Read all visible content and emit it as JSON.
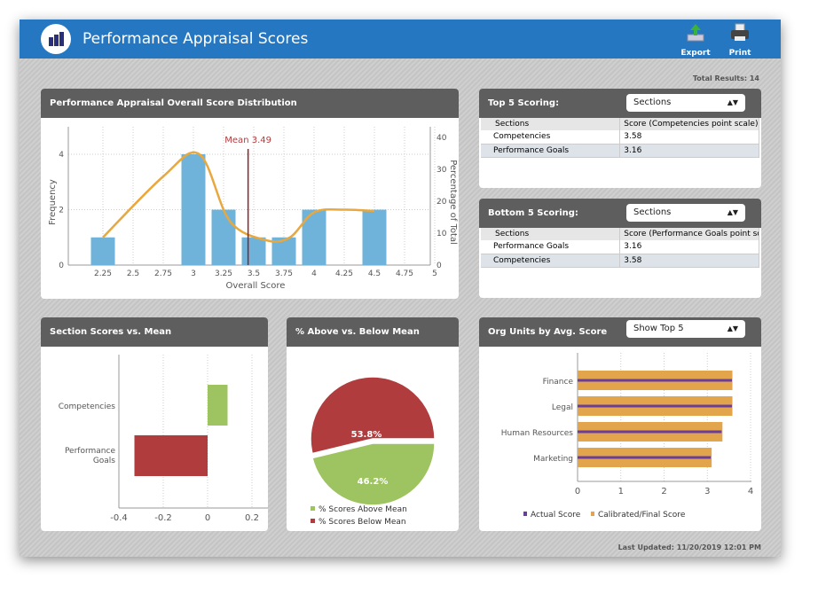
{
  "header": {
    "title": "Performance Appraisal Scores",
    "logo_icon": "bar-chart-icon",
    "export_label": "Export",
    "print_label": "Print"
  },
  "total_results": "Total Results: 14",
  "last_updated": "Last Updated: 11/20/2019 12:01 PM",
  "colors": {
    "header": "#2577c2",
    "panel_header": "#5e5e5e",
    "bar_blue": "#6fb3da",
    "curve": "#e8a83e",
    "mean": "#9b1c1c",
    "green": "#9dc461",
    "red": "#b03c3d",
    "actual": "#6a3d9a",
    "calibrated": "#e2a54c"
  },
  "distribution": {
    "title": "Performance Appraisal Overall Score Distribution"
  },
  "top5": {
    "title": "Top 5 Scoring:",
    "select": "Sections",
    "columns": [
      "Sections",
      "Score (Competencies point scale)"
    ],
    "rows": [
      [
        "Competencies",
        "3.58"
      ],
      [
        "Performance Goals",
        "3.16"
      ]
    ]
  },
  "bottom5": {
    "title": "Bottom 5 Scoring:",
    "select": "Sections",
    "columns": [
      "Sections",
      "Score (Performance Goals point scale)"
    ],
    "rows": [
      [
        "Performance Goals",
        "3.16"
      ],
      [
        "Competencies",
        "3.58"
      ]
    ]
  },
  "sections_panel": {
    "title": "Section Scores vs. Mean"
  },
  "pie_panel": {
    "title": "% Above vs. Below Mean"
  },
  "org_panel": {
    "title": "Org Units by Avg. Score",
    "select": "Show Top 5"
  },
  "chart_data": [
    {
      "type": "bar",
      "title": "",
      "xlabel": "Overall Score",
      "ylabel": "Frequency",
      "y2label": "Percentage of Total",
      "x": [
        2.25,
        3,
        3.25,
        3.5,
        3.75,
        4,
        4.5
      ],
      "values": [
        1,
        4,
        2,
        1,
        1,
        2,
        2
      ],
      "xticks": [
        "2.25",
        "2.5",
        "2.75",
        "3",
        "3.25",
        "3.5",
        "3.75",
        "4",
        "4.25",
        "4.5",
        "4.75",
        "5"
      ],
      "yticks": [
        "0",
        "2",
        "4"
      ],
      "y2ticks": [
        "0",
        "10",
        "20",
        "30",
        "40"
      ],
      "ylim": [
        0,
        5
      ],
      "y2lim": [
        0,
        43
      ],
      "curve": [
        [
          2.25,
          1
        ],
        [
          2.75,
          3.2
        ],
        [
          3.05,
          4
        ],
        [
          3.3,
          1.6
        ],
        [
          3.6,
          0.9
        ],
        [
          3.8,
          1.0
        ],
        [
          4.0,
          1.9
        ],
        [
          4.25,
          2.0
        ],
        [
          4.5,
          1.95
        ]
      ],
      "mean": 3.49,
      "mean_label": "Mean 3.49",
      "grid": true
    },
    {
      "type": "bar",
      "orientation": "horizontal",
      "categories": [
        "Competencies",
        "Performance Goals"
      ],
      "values": [
        0.09,
        -0.33
      ],
      "xticks": [
        "-0.4",
        "-0.2",
        "0",
        "0.2"
      ],
      "xlim": [
        -0.4,
        0.2
      ],
      "grid": true
    },
    {
      "type": "pie",
      "series": [
        {
          "name": "% Scores Above Mean",
          "value": 46.2,
          "label": "46.2%"
        },
        {
          "name": "% Scores Below Mean",
          "value": 53.8,
          "label": "53.8%"
        }
      ],
      "legend": "bottom"
    },
    {
      "type": "bar",
      "orientation": "horizontal",
      "categories": [
        "Finance",
        "Legal",
        "Human Resources",
        "Marketing"
      ],
      "series": [
        {
          "name": "Actual Score",
          "values": [
            3.57,
            3.57,
            3.33,
            3.08
          ]
        },
        {
          "name": "Calibrated/Final Score",
          "values": [
            3.58,
            3.58,
            3.35,
            3.1
          ]
        }
      ],
      "xticks": [
        "0",
        "1",
        "2",
        "3",
        "4"
      ],
      "xlim": [
        0,
        4
      ],
      "legend": "bottom",
      "grid": true
    }
  ]
}
